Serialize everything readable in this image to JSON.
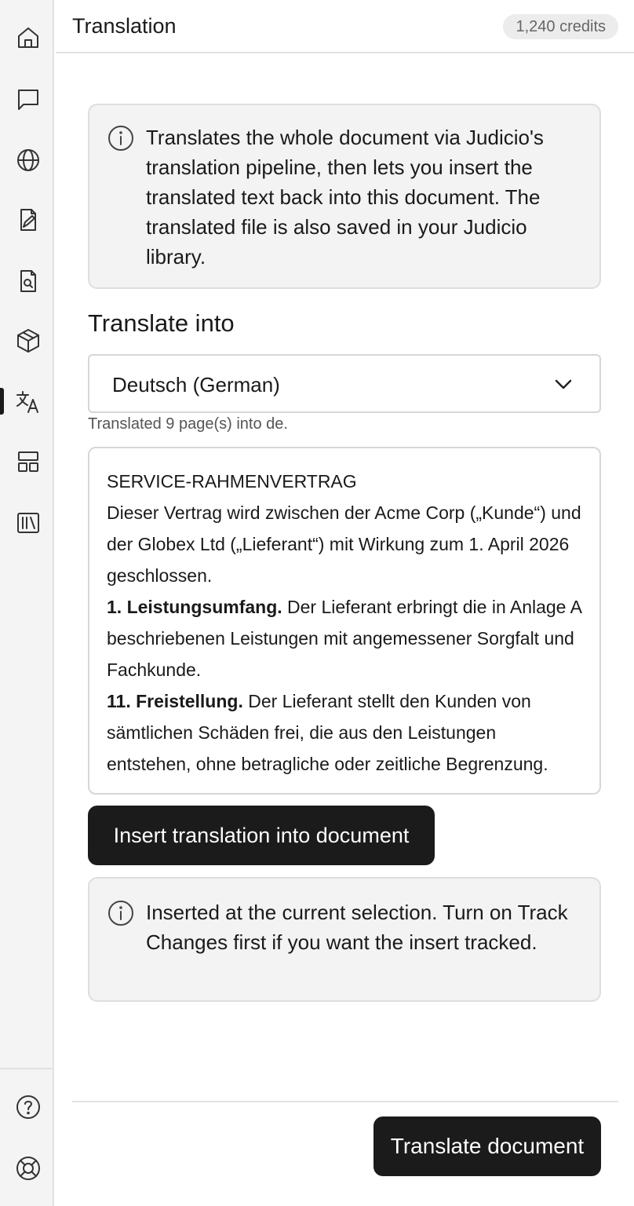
{
  "header": {
    "title": "Translation",
    "credits": "1,240 credits"
  },
  "sidebar": {
    "items": [
      {
        "icon": "home-icon"
      },
      {
        "icon": "chat-icon"
      },
      {
        "icon": "globe-icon"
      },
      {
        "icon": "document-edit-icon"
      },
      {
        "icon": "document-search-icon"
      },
      {
        "icon": "cube-icon"
      },
      {
        "icon": "translate-icon",
        "active": true
      },
      {
        "icon": "layout-icon"
      },
      {
        "icon": "library-icon"
      }
    ],
    "bottom_items": [
      {
        "icon": "help-icon"
      },
      {
        "icon": "lifebuoy-icon"
      }
    ]
  },
  "info_top": {
    "text": "Translates the whole document via Judicio's translation pipeline, then lets you insert the translated text back into this document. The translated file is also saved in your Judicio library."
  },
  "translate_into": {
    "label": "Translate into",
    "selected": "Deutsch (German)",
    "status": "Translated 9 page(s) into de."
  },
  "preview": {
    "title": "SERVICE-RAHMENVERTRAG",
    "intro": "Dieser Vertrag wird zwischen der Acme Corp („Kunde“) und der Globex Ltd („Lieferant“) mit Wirkung zum 1. April 2026 geschlossen.",
    "clause1_heading": "1. Leistungsumfang.",
    "clause1_text": " Der Lieferant erbringt die in Anlage A beschriebenen Leistungen mit angemessener Sorgfalt und Fachkunde.",
    "clause11_heading": "11. Freistellung.",
    "clause11_text": " Der Lieferant stellt den Kunden von sämtlichen Schäden frei, die aus den Leistungen entstehen, ohne betragliche oder zeitliche Begrenzung."
  },
  "insert_button": {
    "label": "Insert translation into document"
  },
  "info_bottom": {
    "text": "Inserted at the current selection. Turn on Track Changes first if you want the insert tracked."
  },
  "translate_button": {
    "label": "Translate document"
  },
  "colors": {
    "primary_button": "#1b1b1b",
    "sidebar_bg": "#f4f4f4",
    "info_bg": "#f3f3f3"
  }
}
